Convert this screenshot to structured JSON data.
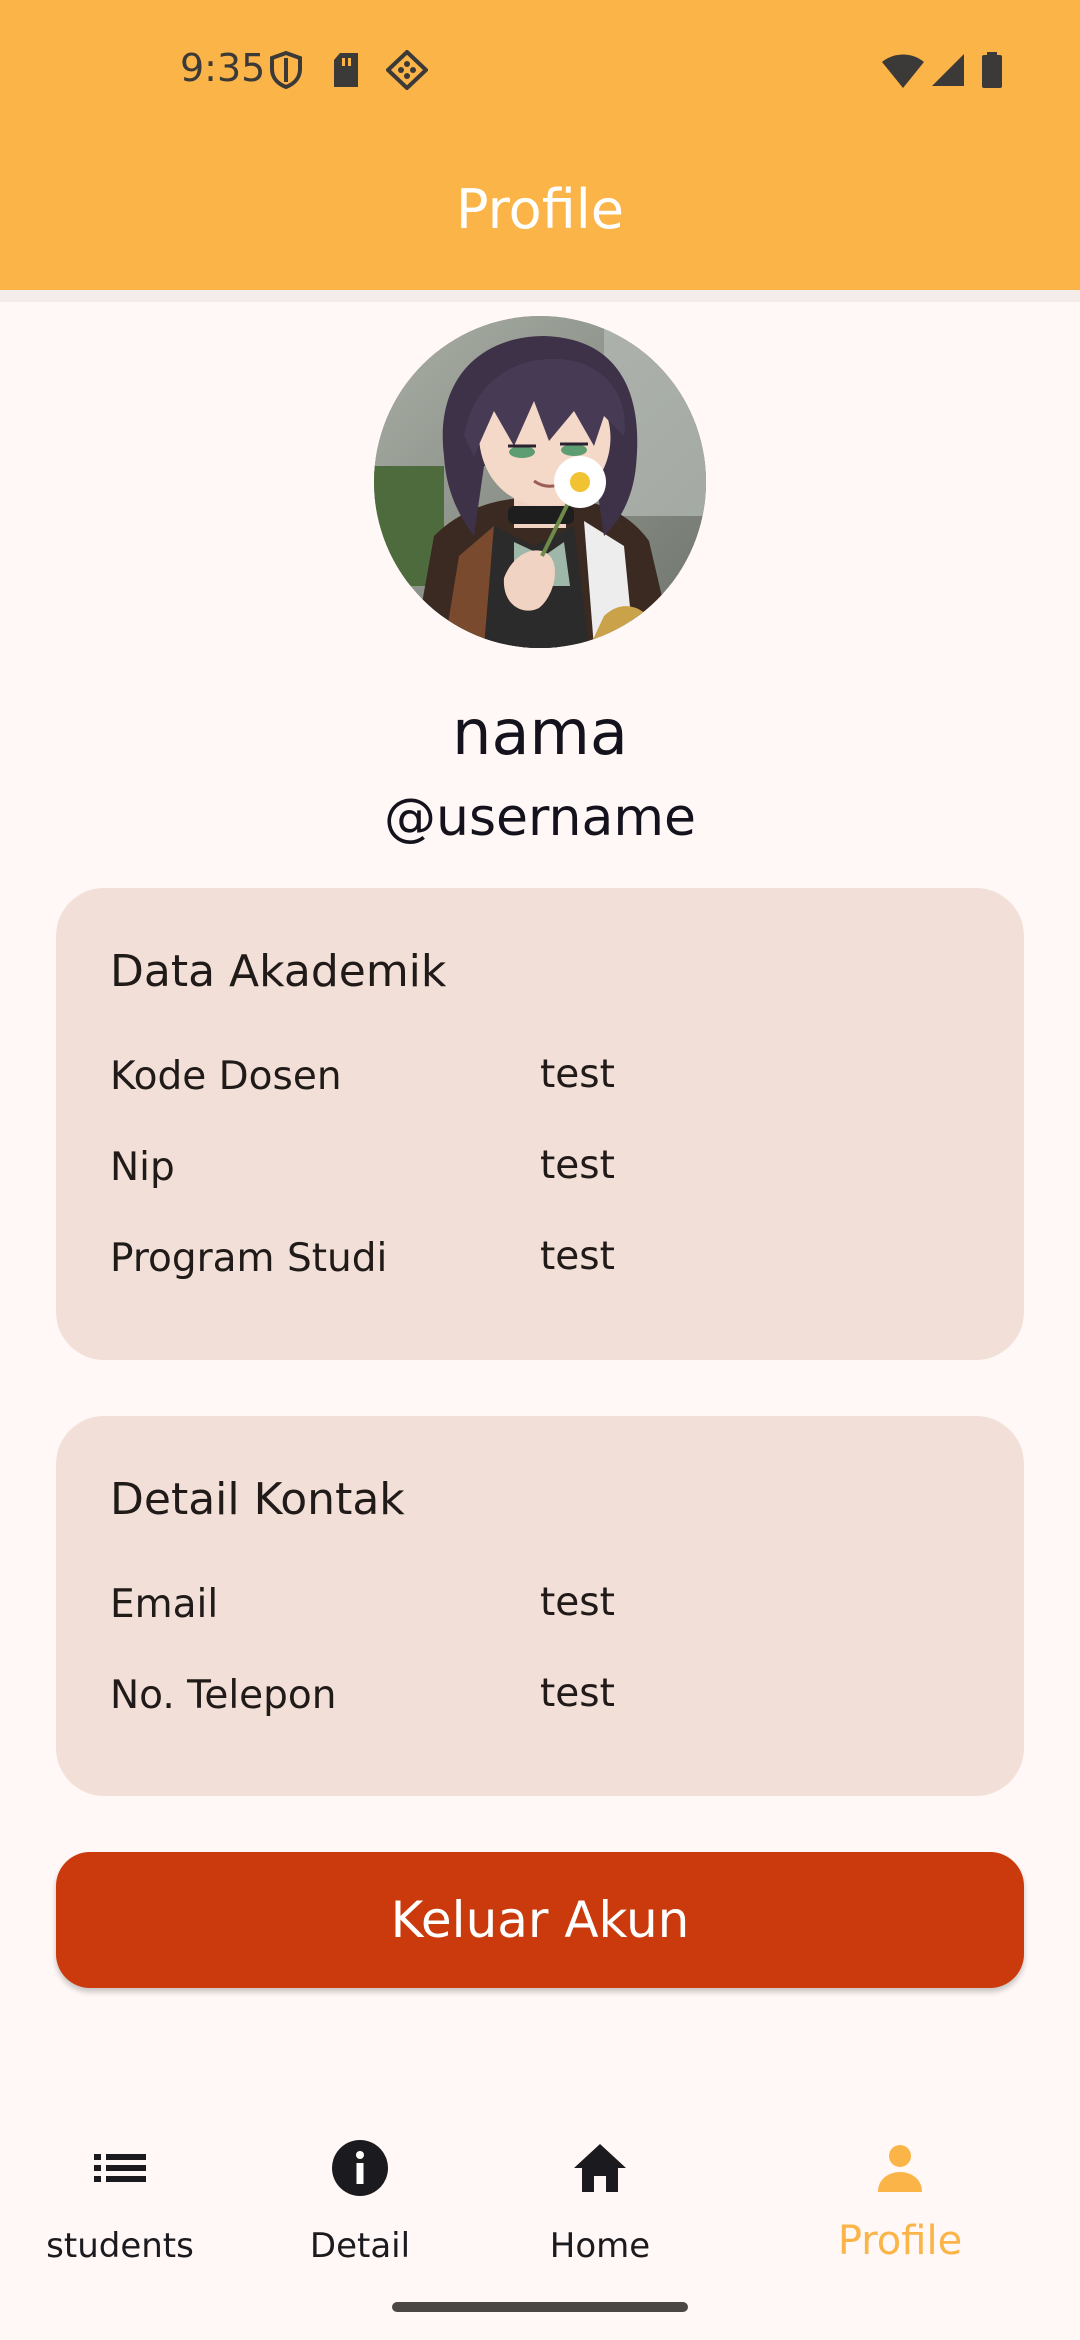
{
  "status_bar": {
    "time": "9:35"
  },
  "header": {
    "title": "Profile",
    "color": "#FBB447"
  },
  "profile": {
    "name": "nama",
    "username": "@username"
  },
  "academic_card": {
    "title": "Data Akademik",
    "rows": [
      {
        "label": "Kode Dosen",
        "value": "test"
      },
      {
        "label": "Nip",
        "value": "test"
      },
      {
        "label": "Program Studi",
        "value": "test"
      }
    ]
  },
  "contact_card": {
    "title": "Detail Kontak",
    "rows": [
      {
        "label": "Email",
        "value": "test"
      },
      {
        "label": "No. Telepon",
        "value": "test"
      }
    ]
  },
  "logout": {
    "label": "Keluar Akun",
    "color": "#CB3A0C"
  },
  "bottom_nav": {
    "items": [
      {
        "label": "students",
        "icon": "list-icon"
      },
      {
        "label": "Detail",
        "icon": "info-icon"
      },
      {
        "label": "Home",
        "icon": "home-icon"
      },
      {
        "label": "Profile",
        "icon": "person-icon",
        "active": true
      }
    ],
    "active_color": "#FBB447"
  }
}
